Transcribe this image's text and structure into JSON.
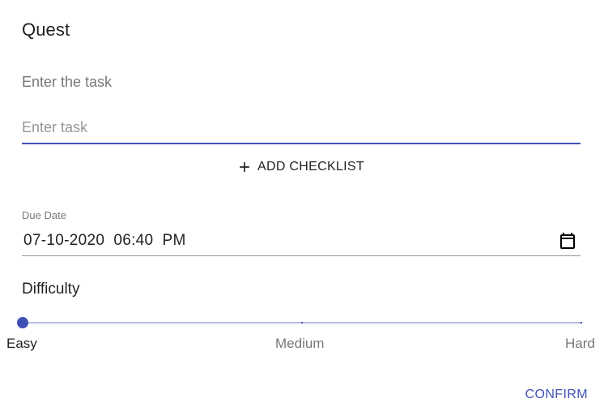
{
  "dialog": {
    "title": "Quest"
  },
  "task": {
    "label": "Enter the task",
    "placeholder": "Enter task",
    "value": ""
  },
  "checklist": {
    "button_label": "ADD CHECKLIST",
    "icon": "plus-icon"
  },
  "due_date": {
    "label": "Due Date",
    "value": "07-10-2020  06:40  PM",
    "icon": "calendar-icon"
  },
  "difficulty": {
    "label": "Difficulty",
    "marks": [
      "Easy",
      "Medium",
      "Hard"
    ],
    "selected_index": 0
  },
  "actions": {
    "confirm_label": "CONFIRM"
  },
  "colors": {
    "primary": "#3f51b5"
  }
}
